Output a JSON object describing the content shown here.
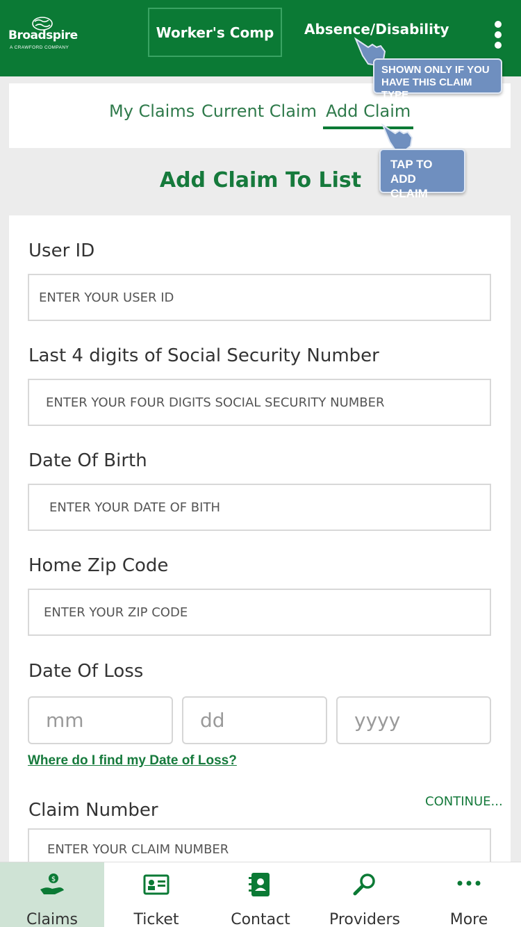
{
  "header": {
    "logo_brand": "Broadspire",
    "logo_tagline": "A CRAWFORD COMPANY",
    "tab_workers_comp": "Worker's Comp",
    "tab_absence": "Absence/Disability"
  },
  "subnav": {
    "my_claims": "My Claims",
    "current_claim": "Current Claim",
    "add_claim": "Add Claim"
  },
  "page_title": "Add Claim To List",
  "form": {
    "user_id": {
      "label": "User ID",
      "placeholder": "ENTER YOUR USER ID"
    },
    "ssn": {
      "label": "Last 4 digits of Social Security Number",
      "placeholder": "ENTER YOUR FOUR DIGITS SOCIAL SECURITY NUMBER"
    },
    "dob": {
      "label": "Date Of Birth",
      "placeholder": "ENTER YOUR DATE OF BITH"
    },
    "zip": {
      "label": "Home Zip Code",
      "placeholder": "ENTER YOUR ZIP CODE"
    },
    "date_of_loss": {
      "label": "Date Of Loss",
      "mm": "mm",
      "dd": "dd",
      "yyyy": "yyyy"
    },
    "help_link": "Where do I find my Date of Loss?",
    "claim_number": {
      "label": "Claim Number",
      "placeholder": "ENTER YOUR CLAIM NUMBER"
    },
    "continue": "CONTINUE..."
  },
  "tooltips": {
    "absence_tip_line1": "SHOWN ONLY IF YOU",
    "absence_tip_line2": "HAVE THIS CLAIM TYPE",
    "add_claim_tip_line1": "TAP TO",
    "add_claim_tip_line2": "ADD CLAIM"
  },
  "bottom_nav": [
    {
      "label": "Claims",
      "icon": "hand-money-icon",
      "active": true
    },
    {
      "label": "Ticket",
      "icon": "id-card-icon",
      "active": false
    },
    {
      "label": "Contact",
      "icon": "address-book-icon",
      "active": false
    },
    {
      "label": "Providers",
      "icon": "search-icon",
      "active": false
    },
    {
      "label": "More",
      "icon": "more-dots-icon",
      "active": false
    }
  ],
  "colors": {
    "brand_green": "#0b7a35",
    "text_green": "#167a3c",
    "tooltip_blue": "#6f8fbf",
    "active_tab_bg": "#cfe3d5"
  }
}
